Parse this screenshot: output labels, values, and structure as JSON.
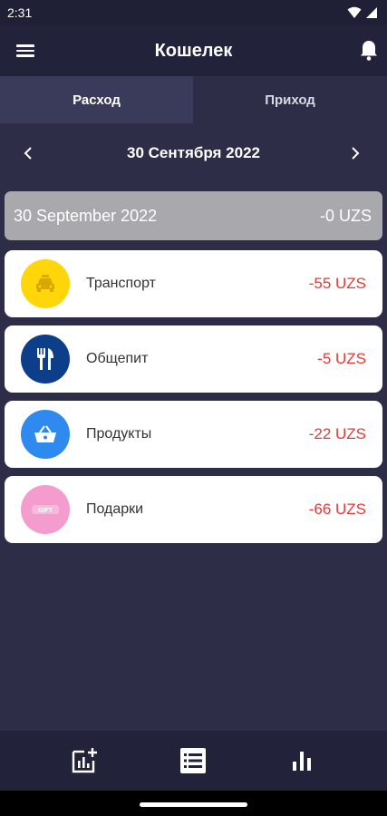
{
  "status_bar": {
    "time": "2:31"
  },
  "app_bar": {
    "title": "Кошелек",
    "menu_icon": "menu-icon",
    "bell_icon": "bell-icon"
  },
  "tabs": [
    {
      "label": "Расход",
      "active": true
    },
    {
      "label": "Приход",
      "active": false
    }
  ],
  "date_nav": {
    "label": "30 Сентября 2022"
  },
  "summary": {
    "date": "30 September 2022",
    "total": "-0 UZS"
  },
  "items": [
    {
      "name": "Транспорт",
      "amount": "-55 UZS",
      "icon": "taxi-icon",
      "color": "#ffd60a"
    },
    {
      "name": "Общепит",
      "amount": "-5 UZS",
      "icon": "restaurant-icon",
      "color": "#0d3e8a"
    },
    {
      "name": "Продукты",
      "amount": "-22 UZS",
      "icon": "basket-icon",
      "color": "#2f8af0"
    },
    {
      "name": "Подарки",
      "amount": "-66 UZS",
      "icon": "gift-icon",
      "color": "#f49ccd",
      "icon_text": "GIFT"
    }
  ],
  "bottom_nav": [
    {
      "icon": "add-chart-icon"
    },
    {
      "icon": "list-icon"
    },
    {
      "icon": "bar-chart-icon"
    }
  ],
  "colors": {
    "background": "#2d2d48",
    "app_bar": "#22223a",
    "expense": "#e53935",
    "summary": "#a9a9ad"
  }
}
